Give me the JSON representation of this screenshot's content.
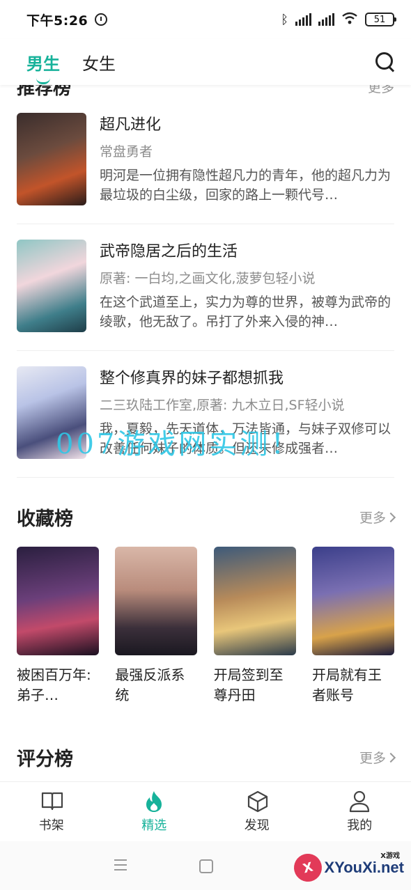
{
  "status_bar": {
    "time": "下午5:26",
    "battery": "51"
  },
  "top_tabs": [
    {
      "label": "男生",
      "active": true
    },
    {
      "label": "女生",
      "active": false
    }
  ],
  "recommend": {
    "title": "推荐榜",
    "more": "更多",
    "items": [
      {
        "title": "超凡进化",
        "author": "常盘勇者",
        "desc": "明河是一位拥有隐性超凡力的青年，他的超凡力为最垃圾的白尘级，回家的路上一颗代号…"
      },
      {
        "title": "武帝隐居之后的生活",
        "author": "原著: 一白均,之画文化,菠萝包轻小说",
        "desc": "在这个武道至上，实力为尊的世界，被尊为武帝的绫歌，他无敌了。吊打了外来入侵的神…"
      },
      {
        "title": "整个修真界的妹子都想抓我",
        "author": "二三玖陆工作室,原著: 九木立日,SF轻小说",
        "desc": "我，夏毅，先天道体，万法皆通，与妹子双修可以改善任何妹子的体质。但还未修成强者…"
      }
    ]
  },
  "watermark": "007游戏网实测！",
  "collection": {
    "title": "收藏榜",
    "more": "更多",
    "items": [
      {
        "title": "被困百万年: 弟子…"
      },
      {
        "title": "最强反派系统"
      },
      {
        "title": "开局签到至尊丹田"
      },
      {
        "title": "开局就有王者账号"
      }
    ]
  },
  "rating": {
    "title": "评分榜",
    "more": "更多"
  },
  "bottom_nav": [
    {
      "label": "书架",
      "icon": "book-icon",
      "active": false
    },
    {
      "label": "精选",
      "icon": "flame-icon",
      "active": true
    },
    {
      "label": "发现",
      "icon": "cube-icon",
      "active": false
    },
    {
      "label": "我的",
      "icon": "user-icon",
      "active": false
    }
  ],
  "logo": {
    "text": "XYouXi.net",
    "small": "X游戏",
    "mark": "X"
  },
  "colors": {
    "accent": "#17b29a"
  }
}
